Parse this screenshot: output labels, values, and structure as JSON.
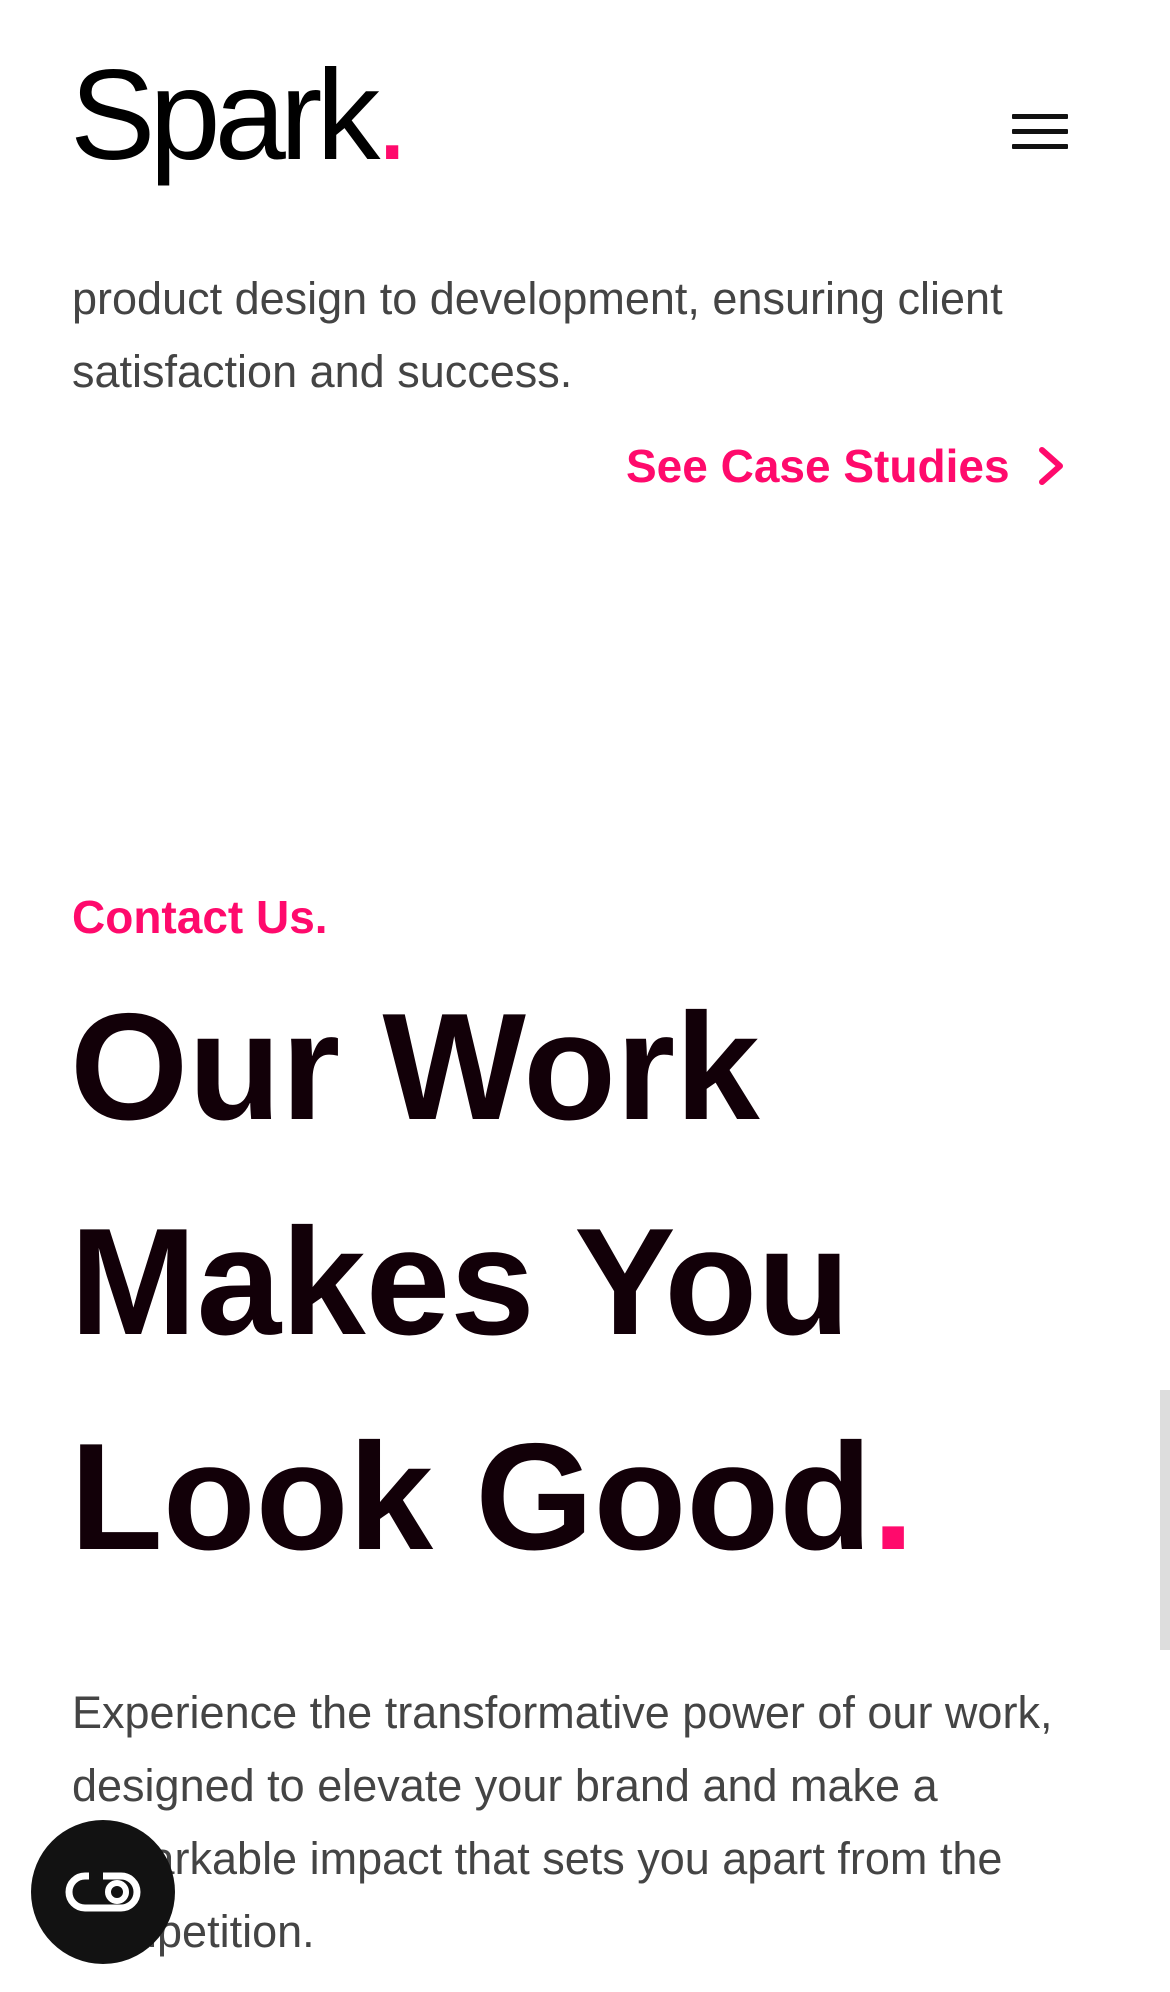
{
  "header": {
    "logo_text": "Spark",
    "logo_dot": ".",
    "menu_icon": "hamburger-menu-icon"
  },
  "intro": {
    "text": "product design to development, ensuring client satisfaction and success.",
    "case_studies_link": "See Case Studies",
    "case_studies_icon": "chevron-right-icon"
  },
  "contact": {
    "eyebrow": "Contact Us.",
    "headline_lines": [
      "Our Work",
      "Makes You",
      "Look Good"
    ],
    "headline_dot": ".",
    "body": "Experience the transformative power of our work, designed to elevate your brand and make a remarkable impact that sets you apart from the competition."
  },
  "floating_button": {
    "icon": "toggle-icon"
  },
  "colors": {
    "accent": "#ff0a6c",
    "heading": "#120008",
    "body_text": "#444444",
    "fab_background": "#121212"
  }
}
